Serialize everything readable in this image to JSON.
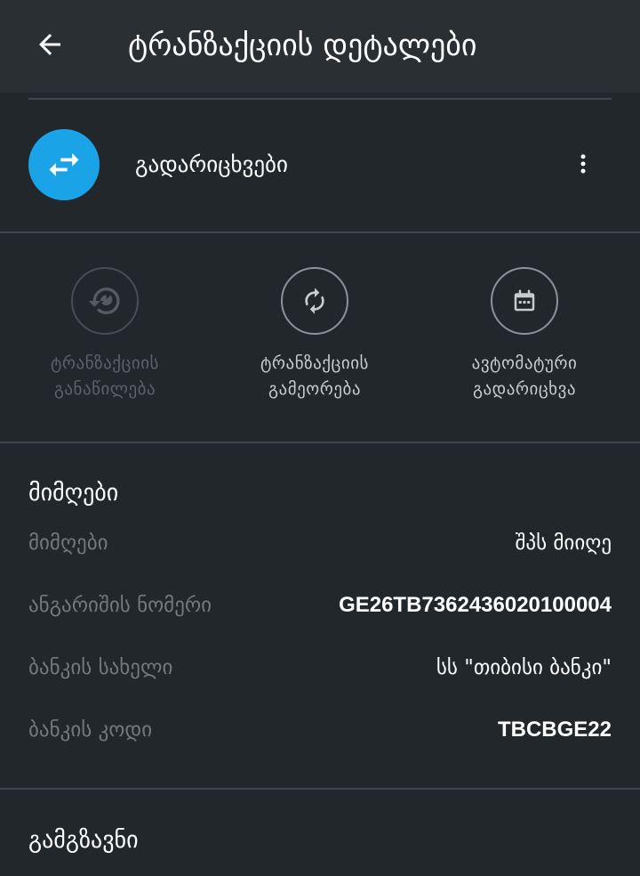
{
  "app_bar": {
    "title": "ტრანზაქციის დეტალები"
  },
  "header": {
    "category": "გადარიცხვები"
  },
  "actions": [
    {
      "label_line1": "ტრანზაქციის",
      "label_line2": "განაწილება",
      "icon": "history-split-icon",
      "enabled": false
    },
    {
      "label_line1": "ტრანზაქციის",
      "label_line2": "გამეორება",
      "icon": "repeat-icon",
      "enabled": true
    },
    {
      "label_line1": "ავტომატური",
      "label_line2": "გადარიცხვა",
      "icon": "calendar-icon",
      "enabled": true
    }
  ],
  "recipient": {
    "section_title": "მიმღები",
    "fields": [
      {
        "label": "მიმღები",
        "value": "შპს მიიღე"
      },
      {
        "label": "ანგარიშის ნომერი",
        "value": "GE26TB7362436020100004"
      },
      {
        "label": "ბანკის სახელი",
        "value": "სს \"თიბისი ბანკი\""
      },
      {
        "label": "ბანკის კოდი",
        "value": "TBCBGE22"
      }
    ]
  },
  "sender": {
    "section_title": "გამგზავნი"
  },
  "colors": {
    "background": "#22272b",
    "app_bar": "#2a2f33",
    "accent": "#1ba3e8",
    "muted_text": "#74797e"
  }
}
